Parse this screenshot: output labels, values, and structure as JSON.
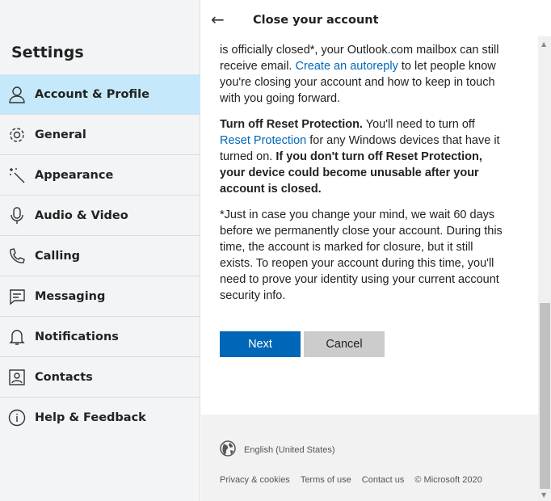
{
  "sidebar": {
    "title": "Settings",
    "items": [
      {
        "label": "Account & Profile",
        "icon": "person-icon",
        "selected": true
      },
      {
        "label": "General",
        "icon": "gear-icon"
      },
      {
        "label": "Appearance",
        "icon": "magic-wand-icon"
      },
      {
        "label": "Audio & Video",
        "icon": "microphone-icon"
      },
      {
        "label": "Calling",
        "icon": "phone-icon"
      },
      {
        "label": "Messaging",
        "icon": "chat-icon"
      },
      {
        "label": "Notifications",
        "icon": "bell-icon"
      },
      {
        "label": "Contacts",
        "icon": "contact-card-icon"
      },
      {
        "label": "Help & Feedback",
        "icon": "info-icon"
      }
    ]
  },
  "header": {
    "title": "Close your account",
    "back_icon": "arrow-left-icon"
  },
  "content": {
    "p1a": "is officially closed*, your Outlook.com mailbox can still receive email. ",
    "p1link": "Create an autoreply",
    "p1b": " to let people know you're closing your account and how to keep in touch with you going forward.",
    "p2bold": "Turn off Reset Protection.",
    "p2a": " You'll need to turn off ",
    "p2link": "Reset Protection",
    "p2b": " for any Windows devices that have it turned on. ",
    "p2bold2": "If you don't turn off Reset Protection, your device could become unusable after your account is closed.",
    "p3": "*Just in case you change your mind, we wait 60 days before we permanently close your account. During this time, the account is marked for closure, but it still exists. To reopen your account during this time, you'll need to prove your identity using your current account security info."
  },
  "buttons": {
    "next": "Next",
    "cancel": "Cancel"
  },
  "footer": {
    "language": "English (United States)",
    "links": [
      "Privacy & cookies",
      "Terms of use",
      "Contact us"
    ],
    "copyright": "© Microsoft 2020"
  },
  "colors": {
    "accent": "#0067b8",
    "selected": "#c5e9fb"
  }
}
